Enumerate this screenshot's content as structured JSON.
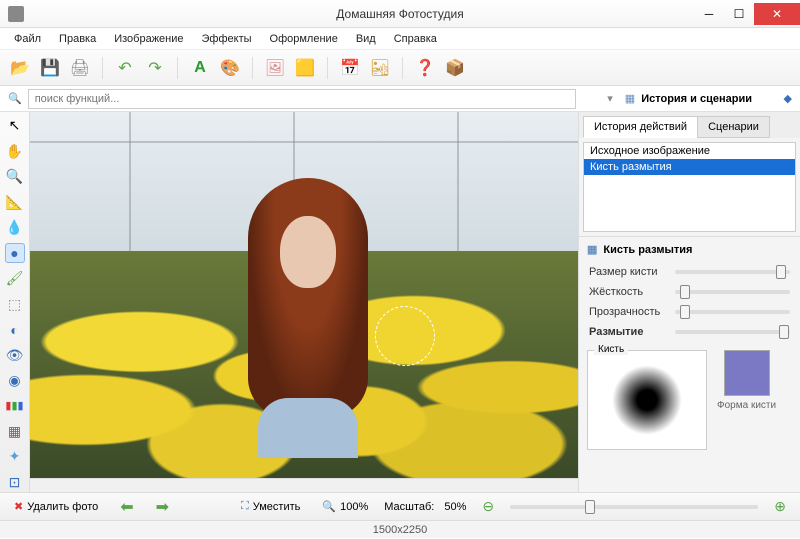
{
  "app": {
    "title": "Домашняя Фотостудия"
  },
  "menu": [
    "Файл",
    "Правка",
    "Изображение",
    "Эффекты",
    "Оформление",
    "Вид",
    "Справка"
  ],
  "toolbar_icons": [
    "folder-open",
    "save",
    "print",
    "undo",
    "redo",
    "text",
    "palette",
    "image-insert",
    "frame",
    "calendar",
    "collage",
    "help",
    "gift"
  ],
  "search": {
    "placeholder": "поиск функций..."
  },
  "left_tools": [
    "pointer",
    "hand",
    "zoom",
    "ruler",
    "eyedropper",
    "blur-brush",
    "brush",
    "eraser",
    "dodge",
    "burn",
    "sponge",
    "rgb",
    "layers",
    "sparkle",
    "crop"
  ],
  "right": {
    "header": "История и сценарии",
    "tabs": {
      "history": "История действий",
      "scenarios": "Сценарии"
    },
    "history_items": [
      "Исходное изображение",
      "Кисть размытия"
    ],
    "tool_header": "Кисть размытия",
    "params": {
      "size": {
        "label": "Размер кисти",
        "pos": 88
      },
      "hardness": {
        "label": "Жёсткость",
        "pos": 4
      },
      "opacity": {
        "label": "Прозрачность",
        "pos": 4
      },
      "blur": {
        "label": "Размытие",
        "pos": 90
      }
    },
    "brush_label": "Кисть",
    "shape_label": "Форма кисти"
  },
  "status": {
    "delete": "Удалить фото",
    "fit": "Уместить",
    "zoom100": "100%",
    "zoom_label": "Масштаб:",
    "zoom_value": "50%"
  },
  "dimensions": "1500x2250"
}
